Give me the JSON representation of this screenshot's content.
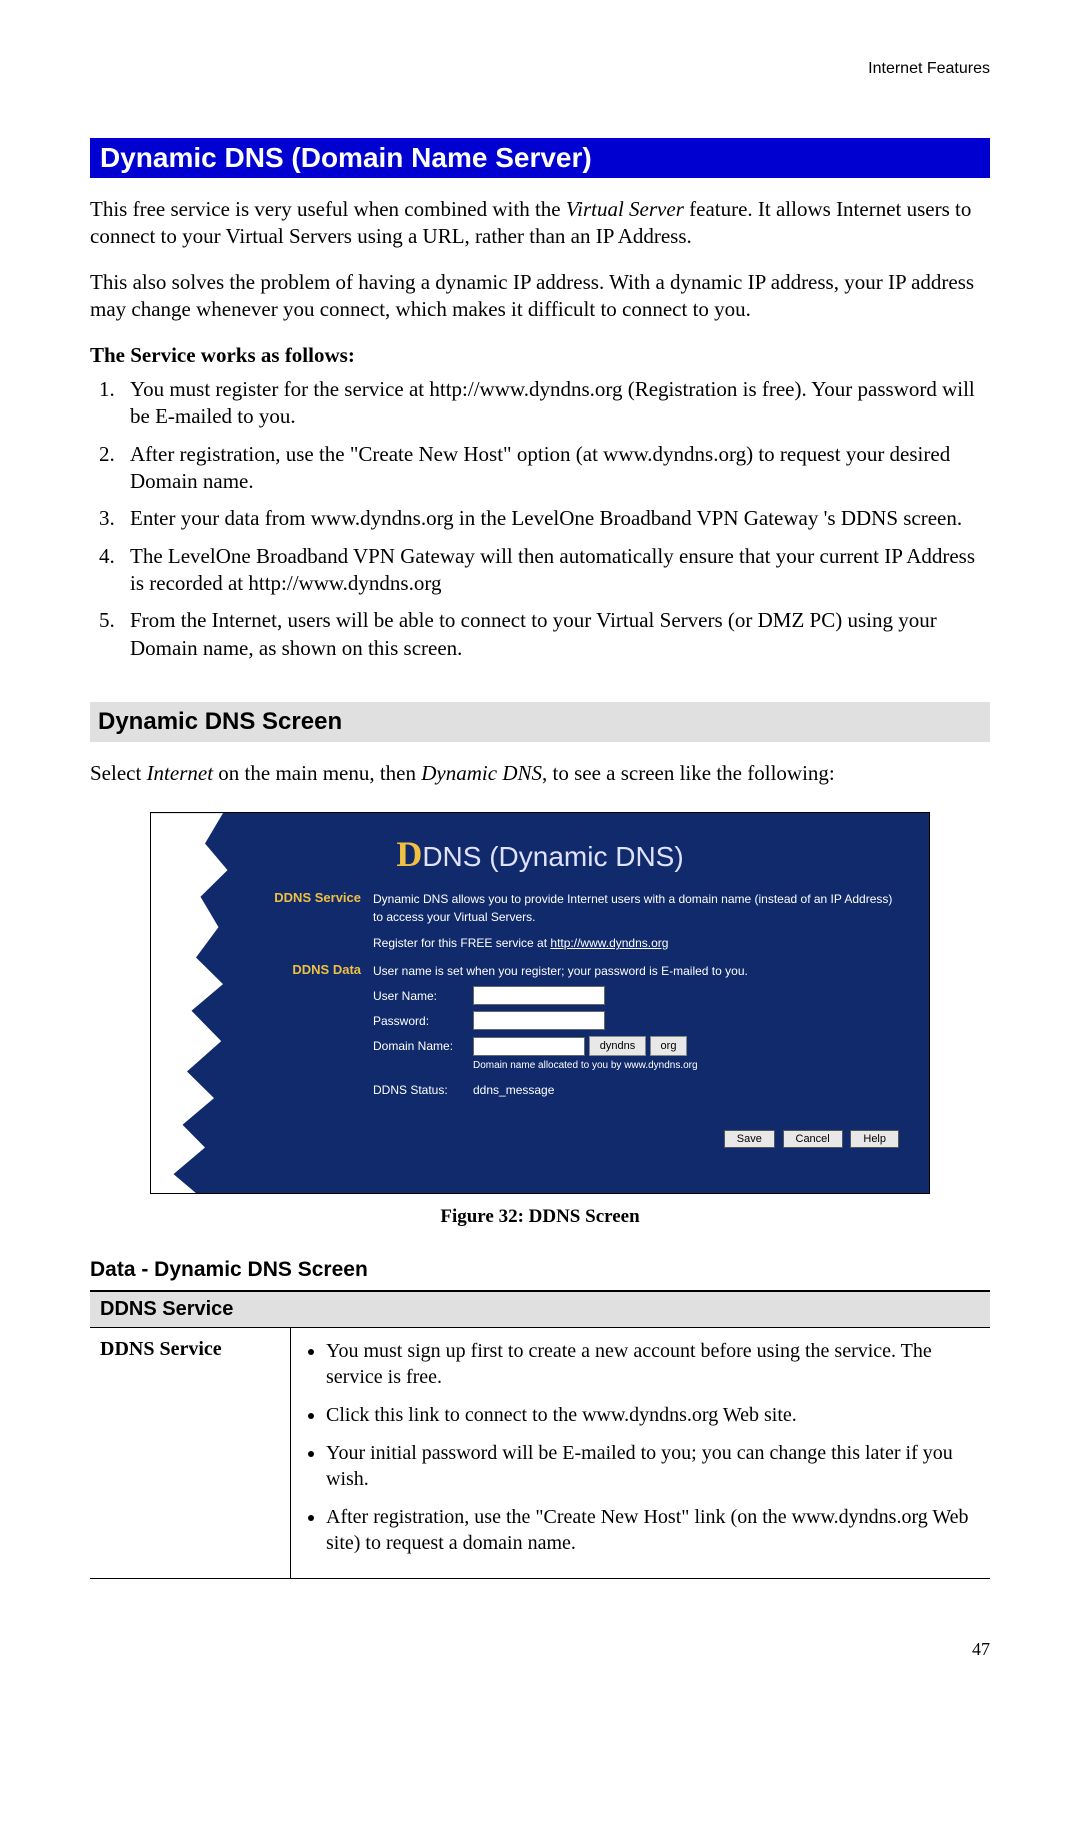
{
  "header": {
    "section": "Internet Features"
  },
  "title": "Dynamic DNS (Domain Name Server)",
  "intro1_a": "This free service is very useful when combined with the ",
  "intro1_b": "Virtual Server",
  "intro1_c": " feature. It allows Internet users to connect to your Virtual Servers using a URL, rather than an IP Address.",
  "intro2": "This also solves the problem of having a dynamic IP address. With a dynamic IP address, your IP address may change whenever you connect, which makes it difficult to connect to you.",
  "steps_heading": "The Service works as follows:",
  "steps": [
    "You must register for the service at http://www.dyndns.org (Registration is free). Your password will be E-mailed to you.",
    "After registration, use the \"Create New Host\" option (at www.dyndns.org) to request your desired Domain name.",
    "Enter your data from www.dyndns.org in the LevelOne Broadband VPN Gateway 's DDNS screen.",
    "The LevelOne Broadband VPN Gateway will then automatically ensure that your current IP Address is recorded at http://www.dyndns.org",
    "From the Internet, users will be able to connect to your Virtual Servers (or DMZ PC) using your Domain name, as shown on this screen."
  ],
  "section2": "Dynamic DNS Screen",
  "section2_intro_a": "Select ",
  "section2_intro_b": "Internet",
  "section2_intro_c": " on the main menu, then ",
  "section2_intro_d": "Dynamic DNS",
  "section2_intro_e": ", to see a screen like the following:",
  "screenshot": {
    "title_prefix": "D",
    "title_rest": "DNS (Dynamic DNS)",
    "rows": {
      "service_label": "DDNS Service",
      "service_text": "Dynamic DNS allows you to provide Internet users with a domain name (instead of an IP Address) to access your Virtual Servers.",
      "service_link_prefix": "Register for this FREE service at ",
      "service_link": "http://www.dyndns.org",
      "data_label": "DDNS Data",
      "data_note": "User name is set when you register; your password is E-mailed to you.",
      "username_label": "User Name:",
      "password_label": "Password:",
      "domain_label": "Domain Name:",
      "domain_sel1": "dyndns",
      "domain_sel2": "org",
      "domain_note": "Domain name allocated to you by www.dyndns.org",
      "status_label": "DDNS Status:",
      "status_value": "ddns_message"
    },
    "buttons": {
      "save": "Save",
      "cancel": "Cancel",
      "help": "Help"
    }
  },
  "figure_caption": "Figure 32: DDNS Screen",
  "data_heading": "Data - Dynamic DNS Screen",
  "table": {
    "header": "DDNS Service",
    "row_label": "DDNS Service",
    "bullets": [
      "You must sign up first to create a new account before using the service. The service is free.",
      "Click this link to connect to the www.dyndns.org Web site.",
      "Your initial password will be E-mailed to you; you can change this later if you wish.",
      "After registration, use the \"Create New Host\" link (on the www.dyndns.org Web site) to request a domain name."
    ]
  },
  "page_number": "47"
}
